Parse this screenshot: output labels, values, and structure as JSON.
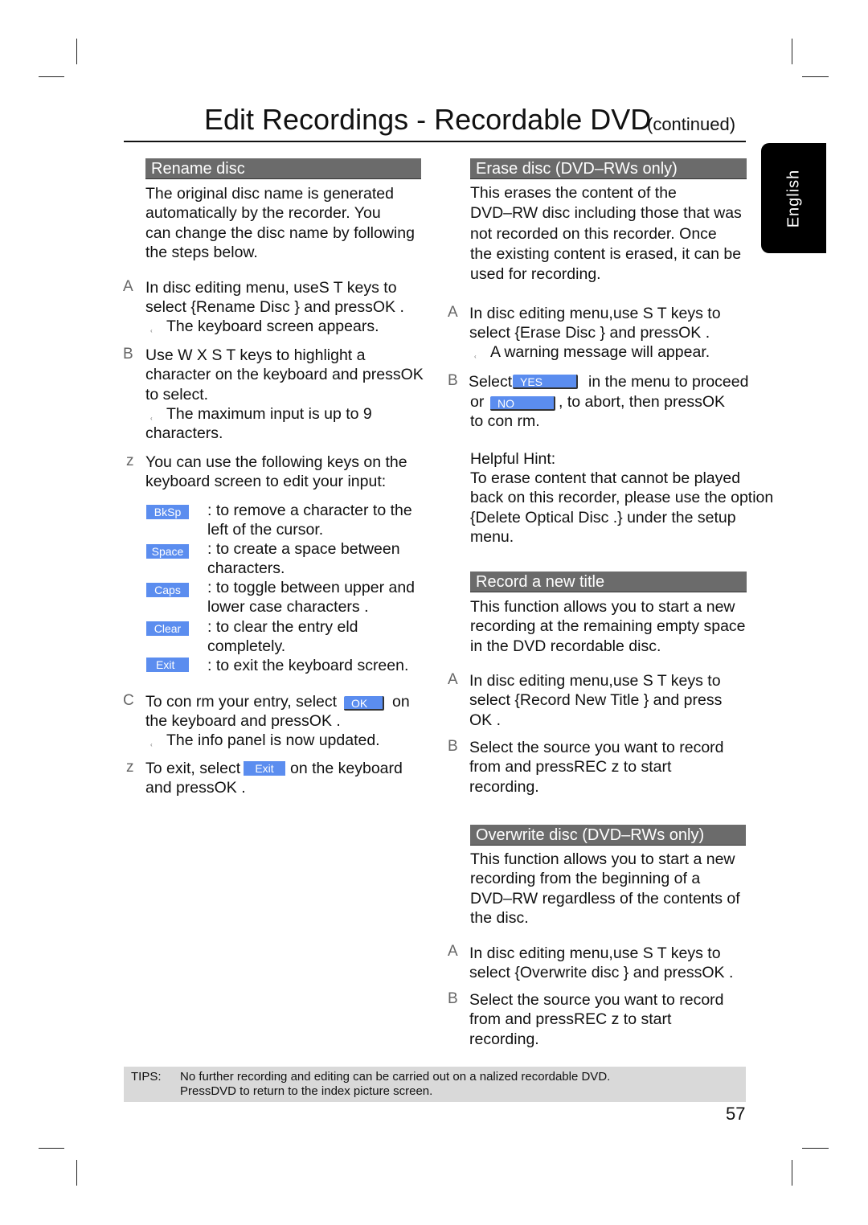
{
  "header": {
    "title": "Edit Recordings - Recordable DVD",
    "continued": "(continued)",
    "language_tab": "English"
  },
  "left": {
    "rename": {
      "heading": "Rename disc",
      "intro": "The original disc name is generated\nautomatically by the recorder. You\ncan change the disc name by following\nthe steps below.",
      "stepA_marker": "A",
      "stepA": "In disc editing menu, useS T  keys to\nselect {Rename Disc } and pressOK .",
      "stepA_result": "The keyboard screen appears.",
      "stepB_marker": "B",
      "stepB": "Use W X S T keys to highlight a\ncharacter on the keyboard and pressOK\nto select.",
      "stepB_result": "The maximum input is up to 9",
      "stepB_result2": "characters.",
      "stepZ_marker": "z",
      "stepZ": "You can use the following keys on the\nkeyboard screen to edit your input:",
      "keys": [
        {
          "label": "BkSp",
          "desc": ": to remove a character to the\n  left of the cursor."
        },
        {
          "label": "Space",
          "desc": ": to create a space between\n  characters."
        },
        {
          "label": "Caps",
          "desc": ": to toggle between upper and\n  lower case characters ."
        },
        {
          "label": "Clear",
          "desc": ": to clear the entry  eld\n  completely."
        },
        {
          "label": "Exit",
          "desc": ": to exit the keyboard screen."
        }
      ],
      "stepC_marker": "C",
      "stepC_1": "To con rm your entry, select",
      "stepC_ok": "OK",
      "stepC_2": "on",
      "stepC_3": "the keyboard and pressOK .",
      "stepC_result": "The info panel is now updated.",
      "stepZ2_marker": "z",
      "stepZ2_1": "To exit, select",
      "stepZ2_exit": "Exit",
      "stepZ2_2": "on the keyboard",
      "stepZ2_3": "and pressOK ."
    }
  },
  "right": {
    "erase": {
      "heading": "Erase disc (DVD–RWs only)",
      "intro": "This erases the content of the\nDVD–RW disc including those that was\nnot recorded on this recorder. Once\nthe existing content is erased, it can be\nused for recording.",
      "stepA_marker": "A",
      "stepA": "In disc editing menu,use S T  keys to\nselect {Erase Disc } and pressOK .",
      "stepA_result": "A warning message will appear.",
      "stepB_marker": "B",
      "stepB_1": "Select",
      "stepB_yes": "YES",
      "stepB_2": "in the menu to proceed",
      "stepB_3": "or",
      "stepB_no": "NO",
      "stepB_4": ", to abort, then pressOK",
      "stepB_5": "to con rm.",
      "hint_title": "Helpful Hint:",
      "hint": "   To erase content that cannot be played\nback on this recorder, please use the option\n{Delete Optical Disc .} under the setup\nmenu."
    },
    "record": {
      "heading": "Record a new title",
      "intro": "This function allows you to start a new\nrecording at the remaining empty space\nin the DVD recordable disc.",
      "stepA_marker": "A",
      "stepA": "In disc editing menu,use S T  keys to\nselect {Record New Title    } and press\nOK .",
      "stepB_marker": "B",
      "stepB": "Select the source you want to record\nfrom and pressREC  z to start\nrecording."
    },
    "overwrite": {
      "heading": "Overwrite disc (DVD–RWs only)",
      "intro": "This function allows you to start a new\nrecording from the beginning of a\nDVD–RW regardless of the contents of\nthe disc.",
      "stepA_marker": "A",
      "stepA": "In disc editing menu,use S T  keys to\nselect {Overwrite disc    } and pressOK .",
      "stepB_marker": "B",
      "stepB": "Select the source you want to record\nfrom and pressREC  z to start\nrecording."
    }
  },
  "tips": {
    "label": "TIPS:",
    "line1": "No further recording and editing can be carried out on a  nalized recordable DVD.",
    "line2": "PressDVD  to return to the index picture screen."
  },
  "page_number": "57",
  "colors": {
    "section_heading": "#6b6b6b",
    "key_button": "#5b8def",
    "tips_background": "#d9d9d9",
    "language_tab": "#000000"
  }
}
